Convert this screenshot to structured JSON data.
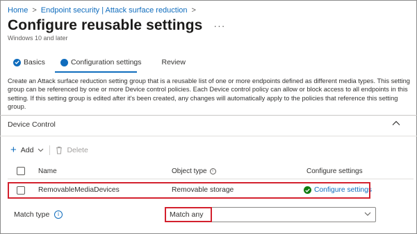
{
  "breadcrumb": {
    "items": [
      "Home",
      "Endpoint security | Attack surface reduction"
    ],
    "separator": ">"
  },
  "header": {
    "title": "Configure reusable settings",
    "more_label": "···",
    "subtitle": "Windows 10 and later"
  },
  "steps": [
    {
      "label": "Basics",
      "state": "completed"
    },
    {
      "label": "Configuration settings",
      "state": "current"
    },
    {
      "label": "Review",
      "state": "pending"
    }
  ],
  "description": "Create an Attack surface reduction setting group that is a reusable list of one or more endpoints defined as different media types. This setting group can be referenced by one or more Device control policies. Each Device control policy can allow or block access to all endpoints in this setting. If this setting group is edited after it's been created, any changes will automatically apply to the policies that reference this setting group.",
  "section": {
    "title": "Device Control",
    "collapse_icon": "chevron-up-icon"
  },
  "toolbar": {
    "add_label": "Add",
    "delete_label": "Delete"
  },
  "table": {
    "columns": [
      "Name",
      "Object type",
      "Configure settings"
    ],
    "info_glyph": "i",
    "rows": [
      {
        "name": "RemovableMediaDevices",
        "object_type": "Removable storage",
        "configure": "Configure settings"
      }
    ]
  },
  "match_type": {
    "label": "Match type",
    "info_glyph": "i",
    "value": "Match any"
  },
  "colors": {
    "accent": "#0f6cbd",
    "highlight": "#d3202d",
    "success": "#107c10"
  }
}
